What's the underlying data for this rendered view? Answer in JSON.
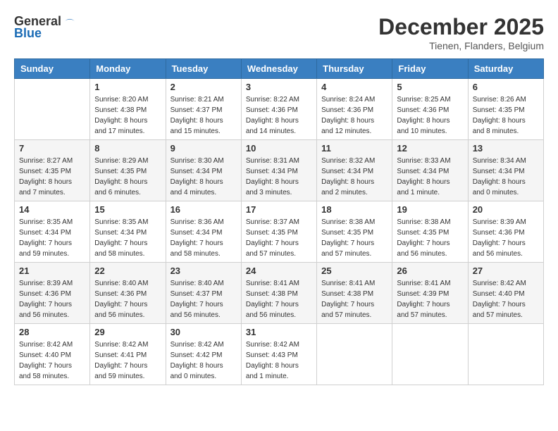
{
  "header": {
    "logo_general": "General",
    "logo_blue": "Blue",
    "month": "December 2025",
    "location": "Tienen, Flanders, Belgium"
  },
  "days_of_week": [
    "Sunday",
    "Monday",
    "Tuesday",
    "Wednesday",
    "Thursday",
    "Friday",
    "Saturday"
  ],
  "weeks": [
    [
      {
        "day": "",
        "sunrise": "",
        "sunset": "",
        "daylight": ""
      },
      {
        "day": "1",
        "sunrise": "Sunrise: 8:20 AM",
        "sunset": "Sunset: 4:38 PM",
        "daylight": "Daylight: 8 hours and 17 minutes."
      },
      {
        "day": "2",
        "sunrise": "Sunrise: 8:21 AM",
        "sunset": "Sunset: 4:37 PM",
        "daylight": "Daylight: 8 hours and 15 minutes."
      },
      {
        "day": "3",
        "sunrise": "Sunrise: 8:22 AM",
        "sunset": "Sunset: 4:36 PM",
        "daylight": "Daylight: 8 hours and 14 minutes."
      },
      {
        "day": "4",
        "sunrise": "Sunrise: 8:24 AM",
        "sunset": "Sunset: 4:36 PM",
        "daylight": "Daylight: 8 hours and 12 minutes."
      },
      {
        "day": "5",
        "sunrise": "Sunrise: 8:25 AM",
        "sunset": "Sunset: 4:36 PM",
        "daylight": "Daylight: 8 hours and 10 minutes."
      },
      {
        "day": "6",
        "sunrise": "Sunrise: 8:26 AM",
        "sunset": "Sunset: 4:35 PM",
        "daylight": "Daylight: 8 hours and 8 minutes."
      }
    ],
    [
      {
        "day": "7",
        "sunrise": "Sunrise: 8:27 AM",
        "sunset": "Sunset: 4:35 PM",
        "daylight": "Daylight: 8 hours and 7 minutes."
      },
      {
        "day": "8",
        "sunrise": "Sunrise: 8:29 AM",
        "sunset": "Sunset: 4:35 PM",
        "daylight": "Daylight: 8 hours and 6 minutes."
      },
      {
        "day": "9",
        "sunrise": "Sunrise: 8:30 AM",
        "sunset": "Sunset: 4:34 PM",
        "daylight": "Daylight: 8 hours and 4 minutes."
      },
      {
        "day": "10",
        "sunrise": "Sunrise: 8:31 AM",
        "sunset": "Sunset: 4:34 PM",
        "daylight": "Daylight: 8 hours and 3 minutes."
      },
      {
        "day": "11",
        "sunrise": "Sunrise: 8:32 AM",
        "sunset": "Sunset: 4:34 PM",
        "daylight": "Daylight: 8 hours and 2 minutes."
      },
      {
        "day": "12",
        "sunrise": "Sunrise: 8:33 AM",
        "sunset": "Sunset: 4:34 PM",
        "daylight": "Daylight: 8 hours and 1 minute."
      },
      {
        "day": "13",
        "sunrise": "Sunrise: 8:34 AM",
        "sunset": "Sunset: 4:34 PM",
        "daylight": "Daylight: 8 hours and 0 minutes."
      }
    ],
    [
      {
        "day": "14",
        "sunrise": "Sunrise: 8:35 AM",
        "sunset": "Sunset: 4:34 PM",
        "daylight": "Daylight: 7 hours and 59 minutes."
      },
      {
        "day": "15",
        "sunrise": "Sunrise: 8:35 AM",
        "sunset": "Sunset: 4:34 PM",
        "daylight": "Daylight: 7 hours and 58 minutes."
      },
      {
        "day": "16",
        "sunrise": "Sunrise: 8:36 AM",
        "sunset": "Sunset: 4:34 PM",
        "daylight": "Daylight: 7 hours and 58 minutes."
      },
      {
        "day": "17",
        "sunrise": "Sunrise: 8:37 AM",
        "sunset": "Sunset: 4:35 PM",
        "daylight": "Daylight: 7 hours and 57 minutes."
      },
      {
        "day": "18",
        "sunrise": "Sunrise: 8:38 AM",
        "sunset": "Sunset: 4:35 PM",
        "daylight": "Daylight: 7 hours and 57 minutes."
      },
      {
        "day": "19",
        "sunrise": "Sunrise: 8:38 AM",
        "sunset": "Sunset: 4:35 PM",
        "daylight": "Daylight: 7 hours and 56 minutes."
      },
      {
        "day": "20",
        "sunrise": "Sunrise: 8:39 AM",
        "sunset": "Sunset: 4:36 PM",
        "daylight": "Daylight: 7 hours and 56 minutes."
      }
    ],
    [
      {
        "day": "21",
        "sunrise": "Sunrise: 8:39 AM",
        "sunset": "Sunset: 4:36 PM",
        "daylight": "Daylight: 7 hours and 56 minutes."
      },
      {
        "day": "22",
        "sunrise": "Sunrise: 8:40 AM",
        "sunset": "Sunset: 4:36 PM",
        "daylight": "Daylight: 7 hours and 56 minutes."
      },
      {
        "day": "23",
        "sunrise": "Sunrise: 8:40 AM",
        "sunset": "Sunset: 4:37 PM",
        "daylight": "Daylight: 7 hours and 56 minutes."
      },
      {
        "day": "24",
        "sunrise": "Sunrise: 8:41 AM",
        "sunset": "Sunset: 4:38 PM",
        "daylight": "Daylight: 7 hours and 56 minutes."
      },
      {
        "day": "25",
        "sunrise": "Sunrise: 8:41 AM",
        "sunset": "Sunset: 4:38 PM",
        "daylight": "Daylight: 7 hours and 57 minutes."
      },
      {
        "day": "26",
        "sunrise": "Sunrise: 8:41 AM",
        "sunset": "Sunset: 4:39 PM",
        "daylight": "Daylight: 7 hours and 57 minutes."
      },
      {
        "day": "27",
        "sunrise": "Sunrise: 8:42 AM",
        "sunset": "Sunset: 4:40 PM",
        "daylight": "Daylight: 7 hours and 57 minutes."
      }
    ],
    [
      {
        "day": "28",
        "sunrise": "Sunrise: 8:42 AM",
        "sunset": "Sunset: 4:40 PM",
        "daylight": "Daylight: 7 hours and 58 minutes."
      },
      {
        "day": "29",
        "sunrise": "Sunrise: 8:42 AM",
        "sunset": "Sunset: 4:41 PM",
        "daylight": "Daylight: 7 hours and 59 minutes."
      },
      {
        "day": "30",
        "sunrise": "Sunrise: 8:42 AM",
        "sunset": "Sunset: 4:42 PM",
        "daylight": "Daylight: 8 hours and 0 minutes."
      },
      {
        "day": "31",
        "sunrise": "Sunrise: 8:42 AM",
        "sunset": "Sunset: 4:43 PM",
        "daylight": "Daylight: 8 hours and 1 minute."
      },
      {
        "day": "",
        "sunrise": "",
        "sunset": "",
        "daylight": ""
      },
      {
        "day": "",
        "sunrise": "",
        "sunset": "",
        "daylight": ""
      },
      {
        "day": "",
        "sunrise": "",
        "sunset": "",
        "daylight": ""
      }
    ]
  ]
}
